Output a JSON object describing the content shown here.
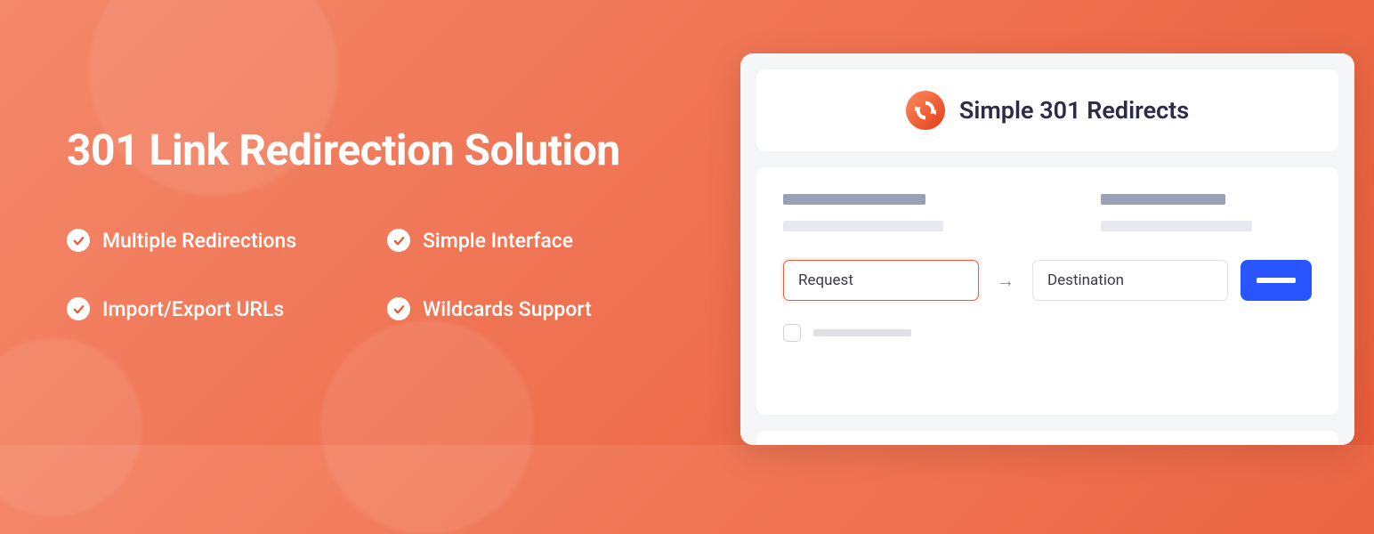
{
  "hero": {
    "heading": "301 Link Redirection Solution",
    "features": [
      "Multiple Redirections",
      "Simple Interface",
      "Import/Export URLs",
      "Wildcards Support"
    ]
  },
  "app": {
    "title": "Simple 301 Redirects",
    "inputs": {
      "request_placeholder": "Request",
      "destination_placeholder": "Destination"
    }
  }
}
